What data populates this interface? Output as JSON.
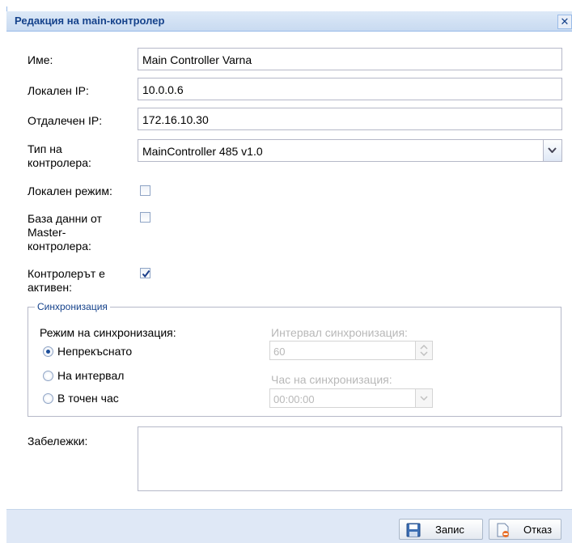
{
  "window": {
    "title": "Редакция на main-контролер",
    "close_glyph": "✕"
  },
  "form": {
    "name": {
      "label": "Име:",
      "value": "Main Controller Varna"
    },
    "local_ip": {
      "label": "Локален IP:",
      "value": "10.0.0.6"
    },
    "remote_ip": {
      "label": "Отдалечен IP:",
      "value": "172.16.10.30"
    },
    "controller_type": {
      "label_line1": "Тип на",
      "label_line2": "контролера:",
      "value": "MainController 485 v1.0"
    },
    "local_mode": {
      "label": "Локален режим:",
      "checked": false
    },
    "master_db": {
      "label_line1": "База данни от",
      "label_line2": "Master-",
      "label_line3": "контролера:",
      "checked": false
    },
    "active": {
      "label_line1": "Контролерът е",
      "label_line2": "активен:",
      "checked": true
    }
  },
  "sync": {
    "legend": "Синхронизация",
    "mode_label": "Режим на синхронизация:",
    "options": [
      {
        "label": "Непрекъснато",
        "checked": true
      },
      {
        "label": "На интервал",
        "checked": false
      },
      {
        "label": "В точен час",
        "checked": false
      }
    ],
    "interval_label": "Интервал синхронизация:",
    "interval_value": "60",
    "time_label": "Час на синхронизация:",
    "time_value": "00:00:00"
  },
  "notes": {
    "label": "Забележки:",
    "value": ""
  },
  "footer": {
    "save_label": "Запис",
    "cancel_label": "Отказ"
  },
  "colors": {
    "title_text": "#15428b",
    "footer_bg": "#dfe8f6",
    "border": "#b5b8c8"
  },
  "icons": {
    "close": "close-icon",
    "save": "floppy-disk-icon",
    "cancel": "cancel-document-icon",
    "combo": "chevron-down-icon",
    "spinner": "spinner-icon"
  }
}
